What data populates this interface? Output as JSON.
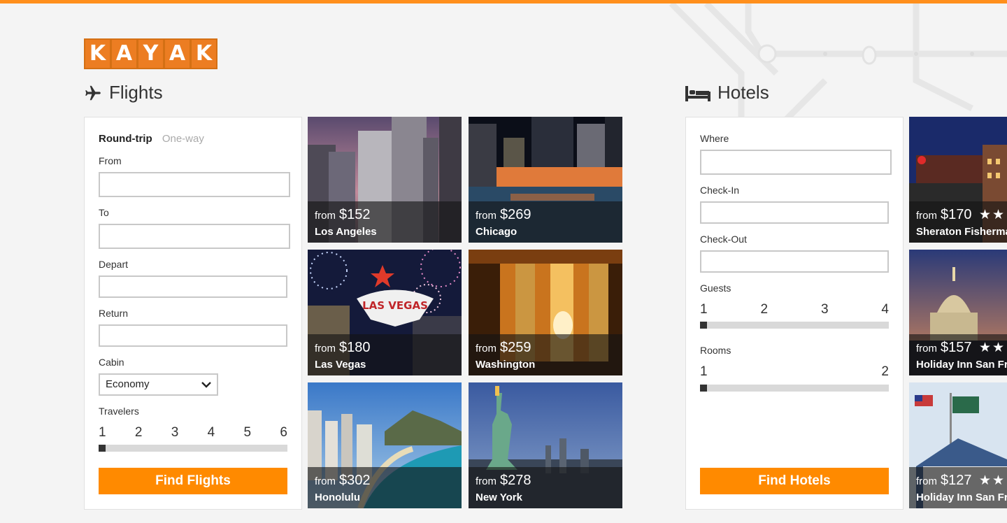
{
  "brand": {
    "letters": [
      "K",
      "A",
      "Y",
      "A",
      "K"
    ]
  },
  "flights": {
    "title": "Flights",
    "trip_types": {
      "active": "Round-trip",
      "inactive": "One-way"
    },
    "from_label": "From",
    "to_label": "To",
    "depart_label": "Depart",
    "return_label": "Return",
    "cabin_label": "Cabin",
    "cabin_value": "Economy",
    "travelers_label": "Travelers",
    "travelers_ticks": [
      "1",
      "2",
      "3",
      "4",
      "5",
      "6"
    ],
    "travelers_value": 1,
    "find_label": "Find Flights",
    "from_prefix": "from",
    "deals": [
      {
        "price": "$152",
        "city": "Los Angeles"
      },
      {
        "price": "$269",
        "city": "Chicago"
      },
      {
        "price": "$180",
        "city": "Las Vegas"
      },
      {
        "price": "$259",
        "city": "Washington"
      },
      {
        "price": "$302",
        "city": "Honolulu"
      },
      {
        "price": "$278",
        "city": "New York"
      }
    ]
  },
  "hotels": {
    "title": "Hotels",
    "where_label": "Where",
    "checkin_label": "Check-In",
    "checkout_label": "Check-Out",
    "guests_label": "Guests",
    "guests_ticks": [
      "1",
      "2",
      "3",
      "4"
    ],
    "guests_value": 1,
    "rooms_label": "Rooms",
    "rooms_ticks": [
      "1",
      "2"
    ],
    "rooms_value": 1,
    "find_label": "Find Hotels",
    "from_prefix": "from",
    "deals": [
      {
        "price": "$170",
        "name": "Sheraton Fisherma",
        "stars": "★★"
      },
      {
        "price": "$157",
        "name": "Holiday Inn San Fr",
        "stars": "★★"
      },
      {
        "price": "$127",
        "name": "Holiday Inn San Fr",
        "stars": "★★"
      }
    ]
  },
  "icons": {
    "flights": "airplane-icon",
    "hotels": "bed-icon",
    "cabin": "chevron-down-icon"
  },
  "colors": {
    "accent": "#ff8a00",
    "brand": "#ec7d22",
    "topbar": "#ff8f1c"
  }
}
